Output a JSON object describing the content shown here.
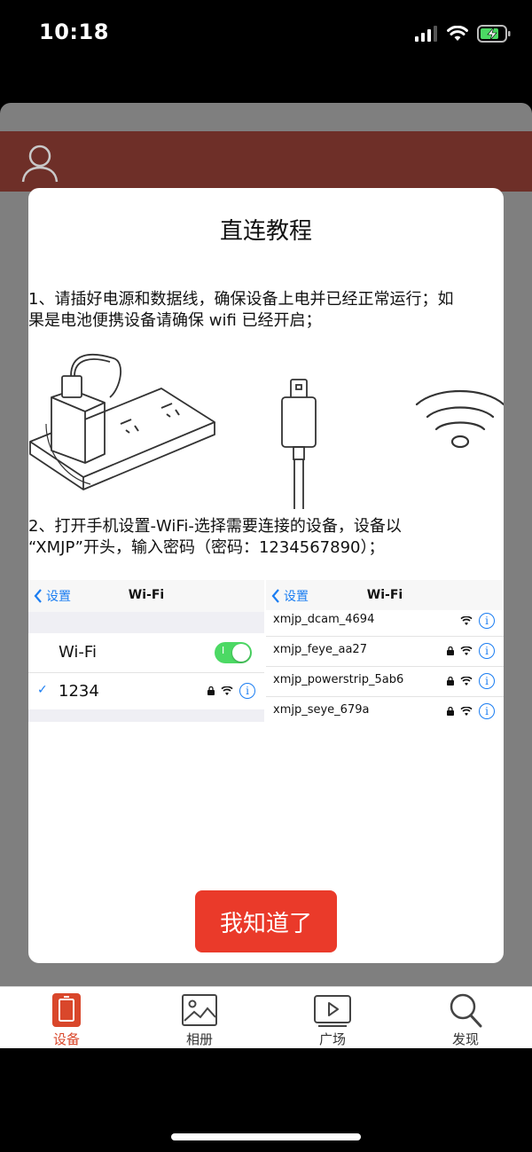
{
  "status_bar": {
    "time": "10:18"
  },
  "modal": {
    "title": "直连教程",
    "step1_line1": "1、请插好电源和数据线，确保设备上电并已经正常运行；如",
    "step1_line2": "果是电池便携设备请确保 wifi 已经开启；",
    "step2_line1": "2、打开手机设置-WiFi-选择需要连接的设备，设备以",
    "step2_line2": "“XMJP”开头，输入密码（密码：1234567890）；",
    "confirm_label": "我知道了"
  },
  "wifi_left": {
    "back_label": "设置",
    "title": "Wi-Fi",
    "wifi_toggle_label": "Wi-Fi",
    "wifi_enabled": true,
    "connected_network": "1234",
    "toggle_text": "I"
  },
  "wifi_right": {
    "back_label": "设置",
    "title": "Wi-Fi",
    "networks": [
      {
        "name": "xmjp_dcam_4694",
        "locked": false
      },
      {
        "name": "xmjp_feye_aa27",
        "locked": true
      },
      {
        "name": "xmjp_powerstrip_5ab6",
        "locked": true
      },
      {
        "name": "xmjp_seye_679a",
        "locked": true
      }
    ]
  },
  "info_glyph": "i",
  "tabs": [
    {
      "label": "设备",
      "icon": "device-icon",
      "active": true
    },
    {
      "label": "相册",
      "icon": "album-icon",
      "active": false
    },
    {
      "label": "广场",
      "icon": "video-play-icon",
      "active": false
    },
    {
      "label": "发现",
      "icon": "search-icon",
      "active": false
    }
  ],
  "colors": {
    "header": "#6e2f28",
    "accent": "#d9472b",
    "button": "#ea3a2a",
    "ios_blue": "#1a7df2",
    "toggle_on": "#4cd964"
  }
}
